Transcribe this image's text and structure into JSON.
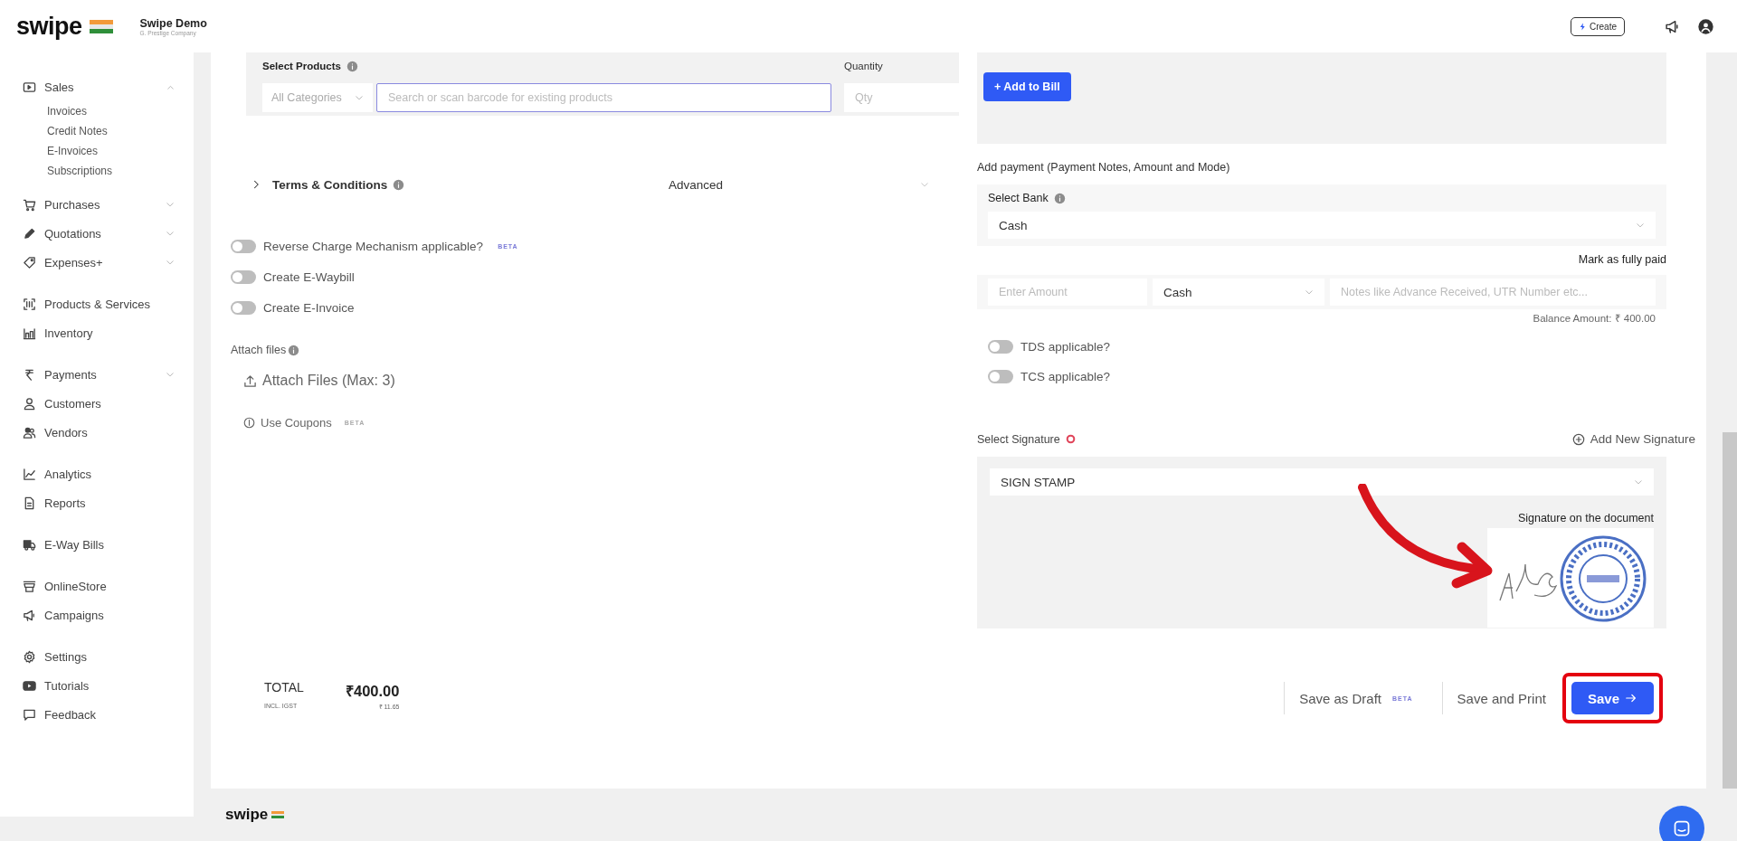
{
  "header": {
    "logo": "swipe",
    "company": "Swipe Demo",
    "company_subtitle": "G. Prestige Company",
    "create_button": "Create"
  },
  "sidebar": {
    "groups": [
      [
        {
          "label": "Sales",
          "kind": "group",
          "expanded": true,
          "children": [
            {
              "label": "Invoices"
            },
            {
              "label": "Credit Notes"
            },
            {
              "label": "E-Invoices"
            },
            {
              "label": "Subscriptions"
            }
          ]
        },
        {
          "label": "Purchases",
          "kind": "group",
          "expanded": false
        },
        {
          "label": "Quotations",
          "kind": "group",
          "expanded": false
        },
        {
          "label": "Expenses+",
          "kind": "group",
          "expanded": false
        }
      ],
      [
        {
          "label": "Products & Services",
          "kind": "link"
        },
        {
          "label": "Inventory",
          "kind": "link"
        }
      ],
      [
        {
          "label": "Payments",
          "kind": "group",
          "expanded": false
        },
        {
          "label": "Customers",
          "kind": "link"
        },
        {
          "label": "Vendors",
          "kind": "link"
        }
      ],
      [
        {
          "label": "Analytics",
          "kind": "link"
        },
        {
          "label": "Reports",
          "kind": "link"
        }
      ],
      [
        {
          "label": "E-Way Bills",
          "kind": "link"
        }
      ],
      [
        {
          "label": "OnlineStore",
          "kind": "link"
        },
        {
          "label": "Campaigns",
          "kind": "link"
        }
      ],
      [
        {
          "label": "Settings",
          "kind": "link"
        },
        {
          "label": "Tutorials",
          "kind": "link"
        },
        {
          "label": "Feedback",
          "kind": "link"
        }
      ]
    ]
  },
  "products": {
    "label": "Select Products",
    "category": "All Categories",
    "search_placeholder": "Search or scan barcode for existing products",
    "quantity_label": "Quantity",
    "quantity_placeholder": "Qty",
    "add_button": "+ Add to Bill"
  },
  "terms": {
    "label": "Terms & Conditions",
    "expanded": false,
    "advanced": "Advanced"
  },
  "toggles": [
    {
      "label": "Reverse Charge Mechanism applicable?",
      "on": false,
      "badge": "BETA"
    },
    {
      "label": "Create E-Waybill",
      "on": false
    },
    {
      "label": "Create E-Invoice",
      "on": false
    }
  ],
  "attach": {
    "label": "Attach files",
    "button": "Attach Files (Max: 3)"
  },
  "coupons": {
    "label": "Use Coupons",
    "badge": "BETA"
  },
  "payment": {
    "title": "Add payment (Payment Notes, Amount and Mode)",
    "bank_label": "Select Bank",
    "bank": "Cash",
    "mark_paid": "Mark as fully paid",
    "amount_placeholder": "Enter Amount",
    "mode": "Cash",
    "notes_placeholder": "Notes like Advance Received, UTR Number etc...",
    "balance": "Balance Amount: ₹ 400.00"
  },
  "tax_toggles": [
    {
      "label": "TDS applicable?",
      "on": false
    },
    {
      "label": "TCS applicable?",
      "on": false
    }
  ],
  "signature": {
    "label": "Select Signature",
    "add": "Add New Signature",
    "selected": "SIGN STAMP",
    "caption": "Signature on the document"
  },
  "totals": {
    "label": "TOTAL",
    "amount": "₹400.00",
    "tax_label": "INCL. IGST",
    "tax": "₹ 11.65"
  },
  "actions": {
    "draft": "Save as Draft",
    "draft_badge": "BETA",
    "print": "Save and Print",
    "save": "Save"
  },
  "footer": {
    "logo": "swipe"
  }
}
